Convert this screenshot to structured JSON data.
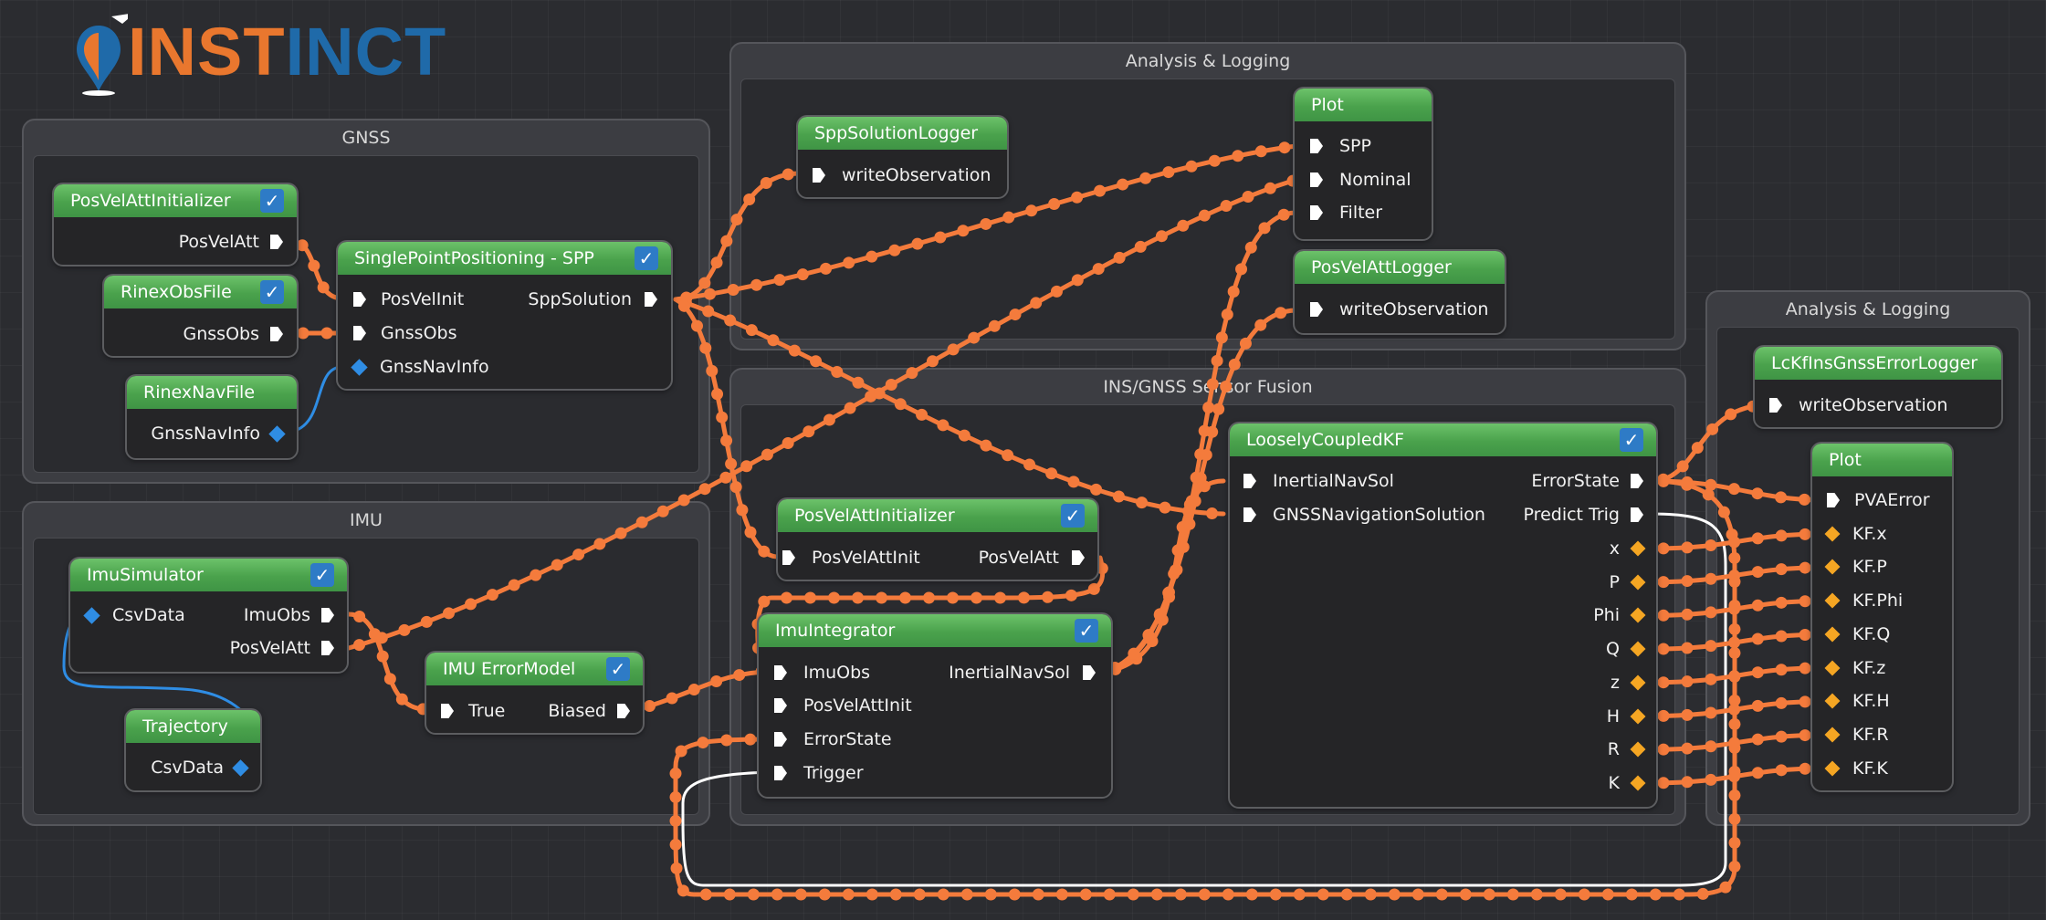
{
  "logo": {
    "text_a": "INST",
    "text_b": "INCT"
  },
  "groups": {
    "gnss": "GNSS",
    "imu": "IMU",
    "analysis1": "Analysis & Logging",
    "fusion": "INS/GNSS Sensor Fusion",
    "analysis2": "Analysis & Logging"
  },
  "nodes": {
    "posVelAttInit1": {
      "title": "PosVelAttInitializer",
      "out": "PosVelAtt"
    },
    "rinexObs": {
      "title": "RinexObsFile",
      "out": "GnssObs"
    },
    "rinexNav": {
      "title": "RinexNavFile",
      "out": "GnssNavInfo"
    },
    "spp": {
      "title": "SinglePointPositioning - SPP",
      "in1": "PosVelInit",
      "in2": "GnssObs",
      "in3": "GnssNavInfo",
      "out": "SppSolution"
    },
    "imuSim": {
      "title": "ImuSimulator",
      "in1": "CsvData",
      "out1": "ImuObs",
      "out2": "PosVelAtt"
    },
    "trajectory": {
      "title": "Trajectory",
      "out": "CsvData"
    },
    "imuError": {
      "title": "IMU ErrorModel",
      "in": "True",
      "out": "Biased"
    },
    "sppLogger": {
      "title": "SppSolutionLogger",
      "in": "writeObservation"
    },
    "plot1": {
      "title": "Plot",
      "in1": "SPP",
      "in2": "Nominal",
      "in3": "Filter"
    },
    "pvaLogger": {
      "title": "PosVelAttLogger",
      "in": "writeObservation"
    },
    "posVelAttInit2": {
      "title": "PosVelAttInitializer",
      "in": "PosVelAttInit",
      "out": "PosVelAtt"
    },
    "imuIntegrator": {
      "title": "ImuIntegrator",
      "in1": "ImuObs",
      "in2": "PosVelAttInit",
      "in3": "ErrorState",
      "in4": "Trigger",
      "out": "InertialNavSol"
    },
    "lckf": {
      "title": "LooselyCoupledKF",
      "in1": "InertialNavSol",
      "in2": "GNSSNavigationSolution",
      "out1": "ErrorState",
      "out2": "Predict Trig",
      "outs": [
        "x",
        "P",
        "Phi",
        "Q",
        "z",
        "H",
        "R",
        "K"
      ]
    },
    "lckfLogger": {
      "title": "LcKfInsGnssErrorLogger",
      "in": "writeObservation"
    },
    "plot2": {
      "title": "Plot",
      "ins": [
        "PVAError",
        "KF.x",
        "KF.P",
        "KF.Phi",
        "KF.Q",
        "KF.z",
        "KF.H",
        "KF.R",
        "KF.K"
      ]
    }
  },
  "colors": {
    "wire": "#f47b3c",
    "wire_flow": "#ffffff",
    "wire_blue": "#2f8de4",
    "header": "#56ad57",
    "check": "#2e7bc6"
  }
}
